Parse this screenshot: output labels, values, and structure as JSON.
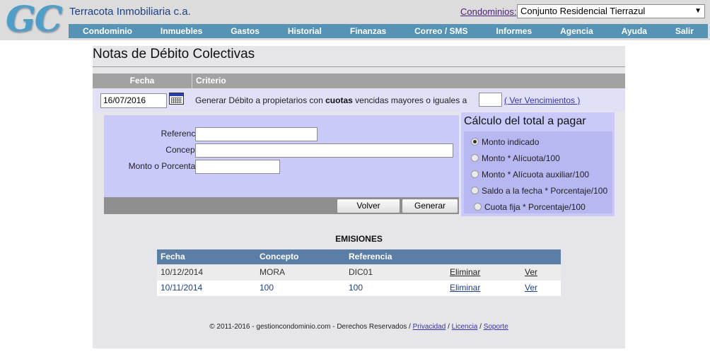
{
  "header": {
    "logo_text": "GC",
    "company": "Terracota Inmobiliaria c.a.",
    "condominios_label": "Condominios:",
    "condominio_selected": "Conjunto Residencial Tierrazul",
    "nav": [
      "Condominio",
      "Inmuebles",
      "Gastos",
      "Historial",
      "Finanzas",
      "Correo / SMS",
      "Informes",
      "Agencia",
      "Ayuda",
      "Salir"
    ]
  },
  "page": {
    "title": "Notas de Débito Colectivas",
    "col_fecha": "Fecha",
    "col_criterio": "Criterio"
  },
  "criteria": {
    "date_value": "16/07/2016",
    "text_before": "Generar Débito a propietarios con",
    "text_bold": "cuotas",
    "text_after": "vencidas mayores o iguales a",
    "cuotas_value": "",
    "ver_vencimientos": "( Ver Vencimientos )"
  },
  "form": {
    "referencia_label": "Referencia:",
    "referencia_value": "",
    "concepto_label": "Concepto:",
    "concepto_value": "",
    "monto_label": "Monto o Porcentaje:",
    "monto_value": "",
    "volver": "Volver",
    "generar": "Generar"
  },
  "calc": {
    "title": "Cálculo del total a pagar",
    "options": [
      "Monto indicado",
      "Monto * Alícuota/100",
      "Monto * Alícuota auxiliar/100",
      "Saldo a la fecha * Porcentaje/100",
      "Cuota fija * Porcentaje/100"
    ],
    "selected": "Monto indicado"
  },
  "emisiones": {
    "title": "EMISIONES",
    "headers": [
      "Fecha",
      "Concepto",
      "Referencia"
    ],
    "rows": [
      {
        "fecha": "10/12/2014",
        "concepto": "MORA",
        "referencia": "DIC01",
        "eliminar": "Eliminar",
        "ver": "Ver"
      },
      {
        "fecha": "10/11/2014",
        "concepto": "100",
        "referencia": "100",
        "eliminar": "Eliminar",
        "ver": "Ver"
      }
    ]
  },
  "footer": {
    "copyright": "© 2011-2016 - gestioncondominio.com - Derechos Reservados /",
    "privacidad": "Privacidad",
    "licencia": "Licencia",
    "soporte": "Soporte",
    "sep": "/"
  },
  "colors": {
    "nav_bg": "#5793b5",
    "panel_bg": "#e6e6ea",
    "form_bg": "#c9c9fa",
    "table_head": "#5b7ea7",
    "row_text_blue": "#1d3f8a"
  }
}
